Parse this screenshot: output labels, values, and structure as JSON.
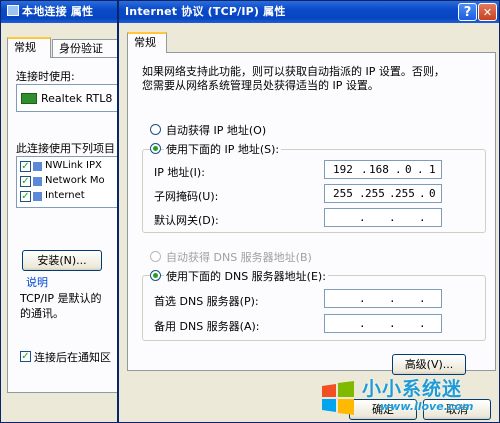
{
  "back_dialog": {
    "title": "本地连接 属性",
    "tabs": [
      "常规",
      "身份验证"
    ],
    "connect_using_label": "连接时使用:",
    "adapter_name": "Realtek RTL8",
    "items_label": "此连接使用下列项目",
    "items": [
      "NWLink IPX",
      "Network Mo",
      "Internet"
    ],
    "install_button": "安装(N)...",
    "description_label": "说明",
    "description_text_1": "TCP/IP 是默认的",
    "description_text_2": "的通讯。",
    "notify_checkbox": "连接后在通知区"
  },
  "dialog": {
    "title": "Internet 协议 (TCP/IP) 属性",
    "help_button": "?",
    "close_button": "✕",
    "tab_general": "常规",
    "intro_line1": "如果网络支持此功能，则可以获取自动指派的 IP 设置。否则，",
    "intro_line2": "您需要从网络系统管理员处获得适当的 IP 设置。",
    "radio_auto_ip": "自动获得 IP 地址(O)",
    "radio_manual_ip": "使用下面的 IP 地址(S):",
    "ip_label": "IP 地址(I):",
    "ip_value": [
      "192",
      "168",
      "0",
      "1"
    ],
    "subnet_label": "子网掩码(U):",
    "subnet_value": [
      "255",
      "255",
      "255",
      "0"
    ],
    "gateway_label": "默认网关(D):",
    "gateway_value": [
      "",
      "",
      "",
      ""
    ],
    "radio_auto_dns": "自动获得 DNS 服务器地址(B)",
    "radio_manual_dns": "使用下面的 DNS 服务器地址(E):",
    "dns_primary_label": "首选 DNS 服务器(P):",
    "dns_alternate_label": "备用 DNS 服务器(A):",
    "advanced_button": "高级(V)...",
    "ok_button": "确定",
    "cancel_button": "取消"
  },
  "watermark": {
    "brand": "小小系统迷",
    "url": "www.llove.com"
  }
}
